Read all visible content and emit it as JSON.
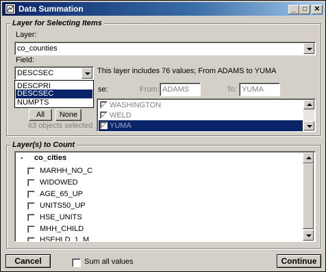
{
  "window": {
    "title": "Data Summation",
    "minimize": "_",
    "maximize": "□",
    "close": "✕"
  },
  "layer_section": {
    "title": "Layer for Selecting Items",
    "layer_label": "Layer:",
    "layer_value": "co_counties",
    "field_label": "Field:",
    "field_value": "DESCSEC",
    "info_text": "This layer includes 76 values; From ADAMS to YUMA",
    "field_options": [
      "DESCPRI",
      "DESCSEC",
      "NUMPTS"
    ],
    "field_selected_index": 1,
    "use_label": "se:",
    "from_label": "From:",
    "from_value": "ADAMS",
    "to_label": "To:",
    "to_value": "YUMA",
    "all_button": "All",
    "none_button": "None",
    "selected_count": "63 objects selected",
    "values": [
      {
        "label": "WASHINGTON",
        "checked": true,
        "selected": false
      },
      {
        "label": "WELD",
        "checked": true,
        "selected": false
      },
      {
        "label": "YUMA",
        "checked": true,
        "selected": true
      }
    ]
  },
  "count_section": {
    "title": "Layer(s) to Count",
    "group_toggle": "-",
    "group_name": "co_cities",
    "fields": [
      "MARHH_NO_C",
      "WIDOWED",
      "AGE_65_UP",
      "UNITS50_UP",
      "HSE_UNITS",
      "MHH_CHILD",
      "HSEHLD_1_M"
    ]
  },
  "footer": {
    "cancel": "Cancel",
    "sum_all_label": "Sum all values",
    "continue": "Continue"
  }
}
